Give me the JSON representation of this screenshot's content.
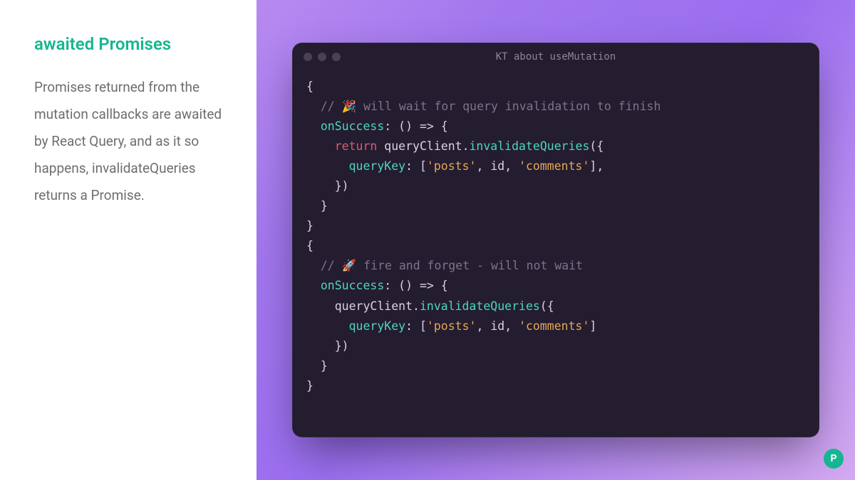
{
  "left": {
    "heading": "awaited Promises",
    "paragraph": "Promises returned from the mutation callbacks are awaited by React Query, and as it so happens, invalidateQueries returns a Promise."
  },
  "editor": {
    "title": "KT about useMutation",
    "code": {
      "l1": "{",
      "l2_open": "  // ",
      "l2_emoji": "🎉",
      "l2_rest": " will wait for query invalidation to finish",
      "l3_key": "onSuccess",
      "l3_rest": ": () => {",
      "l4_ret": "return",
      "l4_var": " queryClient.",
      "l4_meth": "invalidateQueries",
      "l4_paren": "({",
      "l5_key": "queryKey",
      "l5_mid": ": [",
      "l5_s1": "'posts'",
      "l5_c1": ", id, ",
      "l5_s2": "'comments'",
      "l5_end": "],",
      "l6": "    })",
      "l7": "  }",
      "l8": "}",
      "l9": "{",
      "l10_open": "  // ",
      "l10_emoji": "🚀",
      "l10_rest": " fire and forget - will not wait",
      "l11_key": "onSuccess",
      "l11_rest": ": () => {",
      "l12_var": "    queryClient.",
      "l12_meth": "invalidateQueries",
      "l12_paren": "({",
      "l13_key": "queryKey",
      "l13_mid": ": [",
      "l13_s1": "'posts'",
      "l13_c1": ", id, ",
      "l13_s2": "'comments'",
      "l13_end": "]",
      "l14": "    })",
      "l15": "  }",
      "l16": "}"
    }
  },
  "logo_letter": "P",
  "colors": {
    "accent": "#15b690",
    "editor_bg": "#241c2f"
  }
}
